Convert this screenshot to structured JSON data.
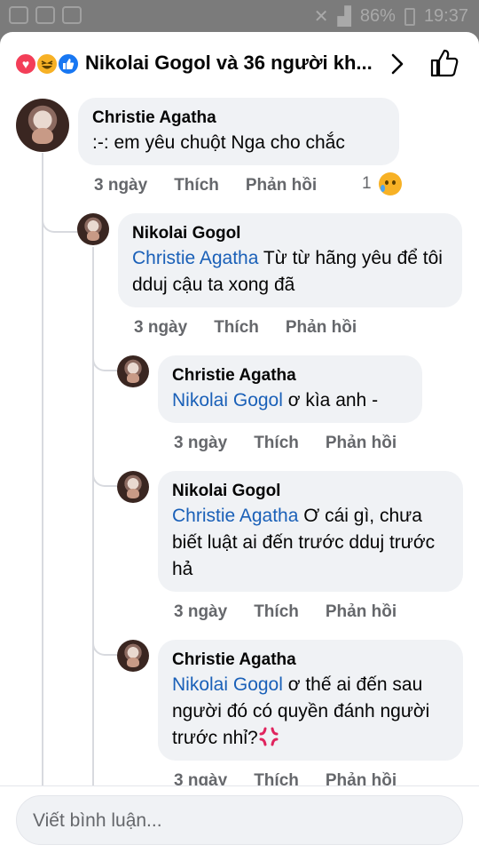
{
  "status_bar": {
    "battery": "86%",
    "time": "19:37"
  },
  "header": {
    "title": "Nikolai Gogol và 36 người kh...",
    "reaction_icons": [
      "love-icon",
      "haha-icon",
      "like-icon"
    ]
  },
  "colors": {
    "mention": "#1a60b8",
    "bubble": "#f0f2f5",
    "meta": "#65676b"
  },
  "comments": [
    {
      "author": "Christie Agatha",
      "mention": "",
      "text": ":-: em yêu chuột Nga cho chắc",
      "time": "3 ngày",
      "like": "Thích",
      "reply": "Phản hồi",
      "reaction_count": "1"
    },
    {
      "author": "Nikolai Gogol",
      "mention": "Christie Agatha",
      "text": " Từ từ hãng yêu để tôi dduj cậu ta xong đã",
      "time": "3 ngày",
      "like": "Thích",
      "reply": "Phản hồi"
    },
    {
      "author": "Christie Agatha",
      "mention": "Nikolai Gogol",
      "text": " ơ kìa anh -",
      "time": "3 ngày",
      "like": "Thích",
      "reply": "Phản hồi"
    },
    {
      "author": "Nikolai Gogol",
      "mention": "Christie Agatha",
      "text": " Ơ cái gì, chưa biết luật ai đến trước dduj trước hả",
      "time": "3 ngày",
      "like": "Thích",
      "reply": "Phản hồi"
    },
    {
      "author": "Christie Agatha",
      "mention": "Nikolai Gogol",
      "text": " ơ thế ai đến sau người đó có quyền đánh người trước nhỉ?",
      "time": "3 ngày",
      "like": "Thích",
      "reply": "Phản hồi"
    }
  ],
  "composer": {
    "placeholder": "Viết bình luận..."
  }
}
